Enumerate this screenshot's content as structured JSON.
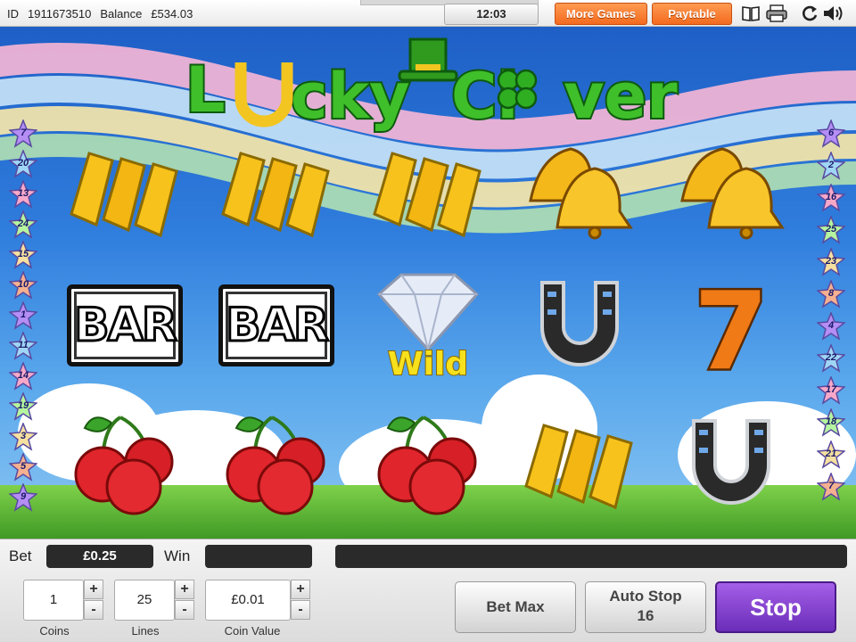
{
  "topbar": {
    "id_label": "ID",
    "id_value": "1911673510",
    "balance_label": "Balance",
    "balance_value": "£534.03",
    "clock": "12:03",
    "more_games": "More Games",
    "paytable": "Paytable",
    "icons": [
      "book-icon",
      "printer-icon",
      "refresh-icon",
      "speaker-icon"
    ]
  },
  "game": {
    "logo": {
      "line1": "L",
      "line2": "cky",
      "line3": "Cl",
      "line4": "ver"
    },
    "wild_label": "Wild",
    "bar_label": "BAR",
    "seven_label": "7",
    "reels": [
      [
        "gold-bars",
        "bar",
        "cherries"
      ],
      [
        "gold-bars",
        "bar",
        "cherries"
      ],
      [
        "gold-bars",
        "wild-diamond",
        "cherries"
      ],
      [
        "bells",
        "horseshoe",
        "gold-bars"
      ],
      [
        "bells",
        "seven",
        "horseshoe"
      ]
    ],
    "left_lines": [
      "7",
      "20",
      "13",
      "24",
      "15",
      "10",
      "1",
      "11",
      "14",
      "19",
      "3",
      "5",
      "9"
    ],
    "right_lines": [
      "6",
      "2",
      "16",
      "25",
      "23",
      "8",
      "4",
      "22",
      "17",
      "18",
      "21",
      "7"
    ]
  },
  "panel": {
    "bet_label": "Bet",
    "bet_value": "£0.25",
    "win_label": "Win",
    "win_value": "",
    "message": "",
    "coins_value": "1",
    "coins_caption": "Coins",
    "lines_value": "25",
    "lines_caption": "Lines",
    "coin_value": "£0.01",
    "coin_value_caption": "Coin Value",
    "plus": "+",
    "minus": "-",
    "bet_max": "Bet Max",
    "auto_stop_label": "Auto Stop",
    "auto_stop_value": "16",
    "stop": "Stop"
  },
  "colors": {
    "accent_orange": "#f36a1e",
    "stop_purple": "#7a3bc8",
    "sky_blue": "#2f7ddd"
  }
}
